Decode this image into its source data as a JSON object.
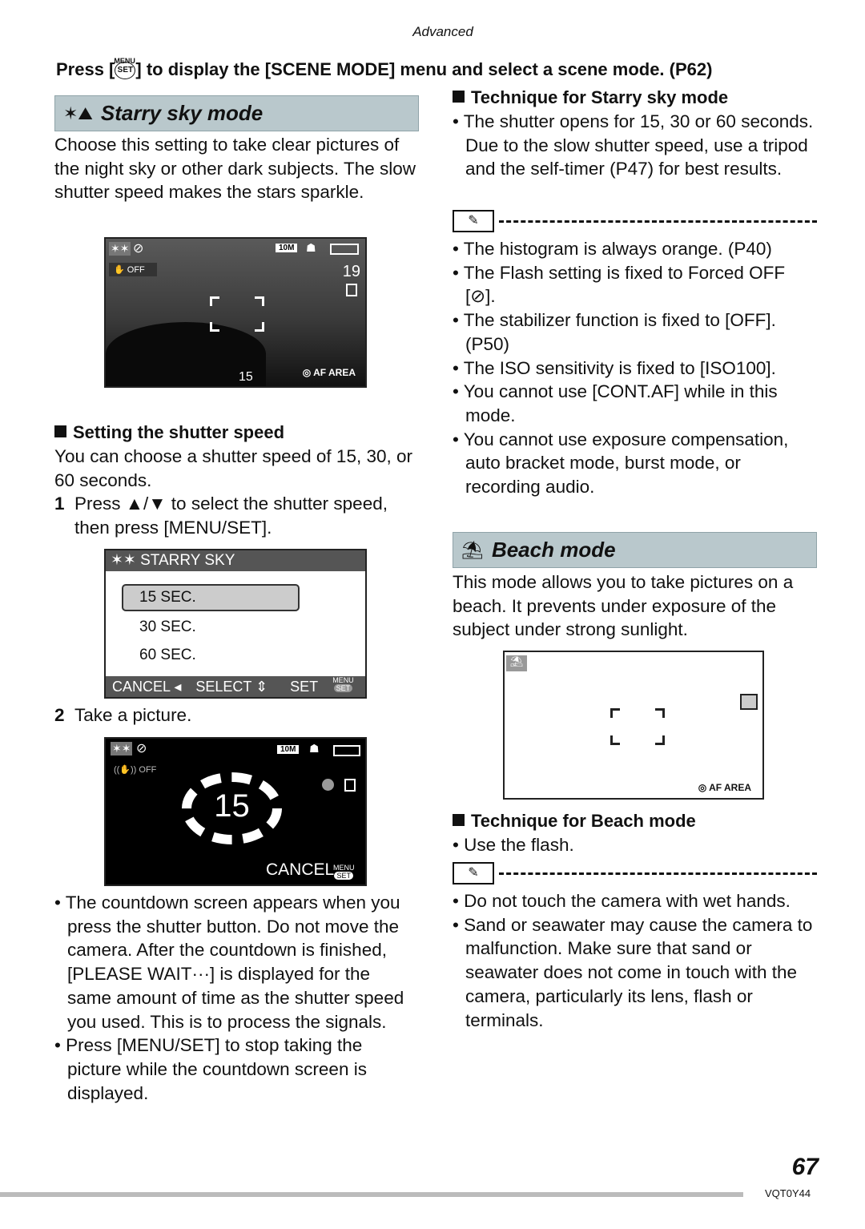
{
  "header": {
    "section": "Advanced"
  },
  "instruction": {
    "pre": "Press [",
    "menu": "MENU",
    "set": "SET",
    "post": "] to display the [SCENE MODE] menu and select a scene mode. (P62)"
  },
  "starry": {
    "title": "Starry sky mode",
    "intro": "Choose this setting to take clear pictures of the night sky or other dark subjects. The slow shutter speed makes the stars sparkle.",
    "screen1": {
      "stabilizer": "OFF",
      "size": "10M",
      "remaining": "19",
      "shutter": "15",
      "af": "AF AREA"
    },
    "shutter_heading": "Setting the shutter speed",
    "shutter_text": "You can choose a shutter speed of 15, 30, or 60 seconds.",
    "step1_num": "1",
    "step1": "Press ▲/▼ to select the shutter speed, then press [MENU/SET].",
    "menu": {
      "title": "STARRY SKY",
      "options": [
        "15 SEC.",
        "30 SEC.",
        "60 SEC."
      ],
      "selected": 0,
      "cancel": "CANCEL ◂",
      "select": "SELECT ⇕",
      "set": "SET",
      "menu_small": "MENU",
      "set_small": "SET"
    },
    "step2_num": "2",
    "step2": "Take a picture.",
    "screen2": {
      "stabilizer": "OFF",
      "size": "10M",
      "countdown": "15",
      "cancel": "CANCEL",
      "menu_small": "MENU",
      "set_small": "SET"
    },
    "bullets": [
      "The countdown screen appears when you press the shutter button. Do not move the camera. After the countdown is finished, [PLEASE WAIT···] is displayed for the same amount of time as the shutter speed you used. This is to process the signals.",
      "Press [MENU/SET] to stop taking the picture while the countdown screen is displayed."
    ],
    "technique_heading": "Technique for Starry sky mode",
    "technique": [
      "The shutter opens for 15, 30 or 60 seconds. Due to the slow shutter speed, use a tripod and the self-timer (P47) for best results."
    ],
    "notes": [
      "The histogram is always orange. (P40)",
      "The Flash setting is fixed to Forced OFF [⊘].",
      "The stabilizer function is fixed to [OFF]. (P50)",
      "The ISO sensitivity is fixed to [ISO100].",
      "You cannot use [CONT.AF] while in this mode.",
      "You cannot use exposure compensation, auto bracket mode, burst mode, or recording audio."
    ]
  },
  "beach": {
    "title": "Beach mode",
    "intro": "This mode allows you to take pictures on a beach. It prevents under exposure of the subject under strong sunlight.",
    "screen": {
      "af": "AF AREA"
    },
    "technique_heading": "Technique for Beach mode",
    "technique": [
      "Use the flash."
    ],
    "notes": [
      "Do not touch the camera with wet hands.",
      "Sand or seawater may cause the camera to malfunction. Make sure that sand or seawater does not come in touch with the camera, particularly its lens, flash or terminals."
    ]
  },
  "footer": {
    "page": "67",
    "code": "VQT0Y44"
  }
}
